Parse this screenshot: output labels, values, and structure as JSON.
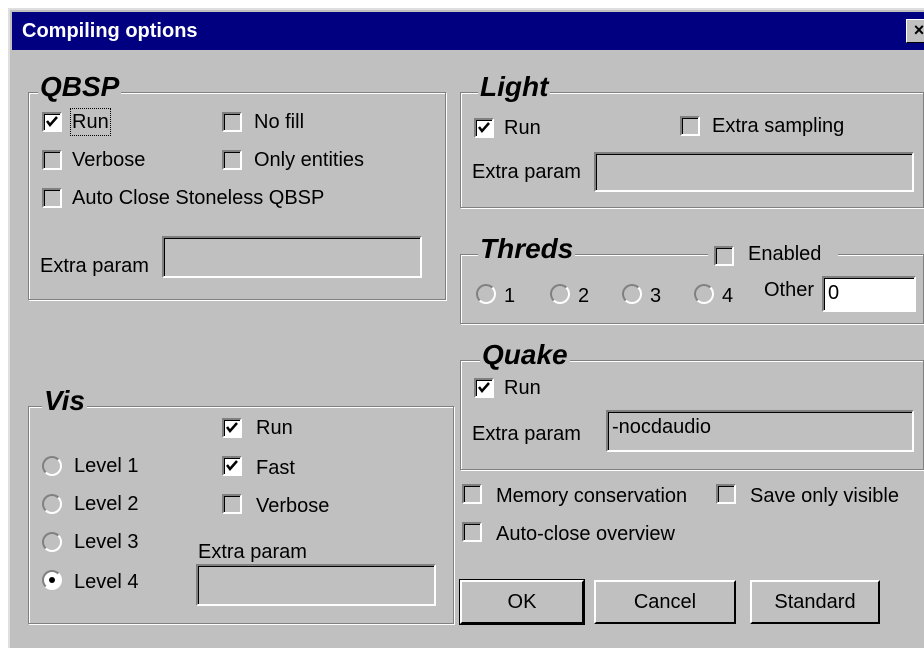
{
  "window": {
    "title": "Compiling options",
    "close_glyph": "×"
  },
  "qbsp": {
    "legend": "QBSP",
    "run": {
      "label": "Run",
      "checked": true
    },
    "no_fill": {
      "label": "No fill",
      "checked": false
    },
    "verbose": {
      "label": "Verbose",
      "checked": false
    },
    "only_entities": {
      "label": "Only entities",
      "checked": false
    },
    "auto_close": {
      "label": "Auto Close Stoneless QBSP",
      "checked": false
    },
    "extra_param_label": "Extra param",
    "extra_param_value": ""
  },
  "light": {
    "legend": "Light",
    "run": {
      "label": "Run",
      "checked": true
    },
    "extra_sampling": {
      "label": "Extra sampling",
      "checked": false
    },
    "extra_param_label": "Extra param",
    "extra_param_value": ""
  },
  "threads": {
    "legend": "Threds",
    "enabled": {
      "label": "Enabled",
      "checked": false
    },
    "options": [
      "1",
      "2",
      "3",
      "4"
    ],
    "other_label": "Other",
    "other_value": "0"
  },
  "quake": {
    "legend": "Quake",
    "run": {
      "label": "Run",
      "checked": true
    },
    "extra_param_label": "Extra param",
    "extra_param_value": "-nocdaudio"
  },
  "vis": {
    "legend": "Vis",
    "run": {
      "label": "Run",
      "checked": true
    },
    "fast": {
      "label": "Fast",
      "checked": true
    },
    "verbose": {
      "label": "Verbose",
      "checked": false
    },
    "levels": [
      "Level 1",
      "Level 2",
      "Level 3",
      "Level 4"
    ],
    "selected_level": "Level 4",
    "extra_param_label": "Extra param",
    "extra_param_value": ""
  },
  "options": {
    "memory_conservation": {
      "label": "Memory conservation",
      "checked": false
    },
    "save_only_visible": {
      "label": "Save only visible",
      "checked": false
    },
    "auto_close_overview": {
      "label": "Auto-close overview",
      "checked": false
    }
  },
  "buttons": {
    "ok": "OK",
    "cancel": "Cancel",
    "standard": "Standard"
  },
  "icons": {
    "check": "check-mark-icon",
    "radio_dot": "radio-dot-icon",
    "close": "close-icon"
  },
  "colors": {
    "face": "#c0c0c0",
    "titlebar": "#000080",
    "title_text": "#ffffff"
  }
}
